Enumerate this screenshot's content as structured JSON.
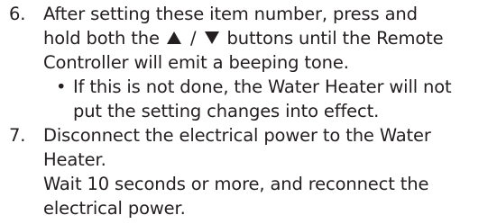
{
  "steps": [
    {
      "number": "6.",
      "line1": "After setting these item number, press and",
      "line2_before": "hold both the",
      "line2_separator": "/",
      "line2_after": "buttons until the Remote",
      "line3": "Controller will emit a beeping tone.",
      "bullet_marker": "•",
      "bullet_line1": "If this is not done, the Water Heater will not",
      "bullet_line2": "put the setting changes into effect."
    },
    {
      "number": "7.",
      "line1": "Disconnect the electrical power to the Water",
      "line2": "Heater.",
      "line3": "Wait 10 seconds or more, and reconnect the",
      "line4": "electrical power."
    }
  ],
  "icons": {
    "up_button": "up-triangle-icon",
    "down_button": "down-triangle-icon"
  },
  "colors": {
    "text": "#231f20",
    "background": "#ffffff"
  }
}
